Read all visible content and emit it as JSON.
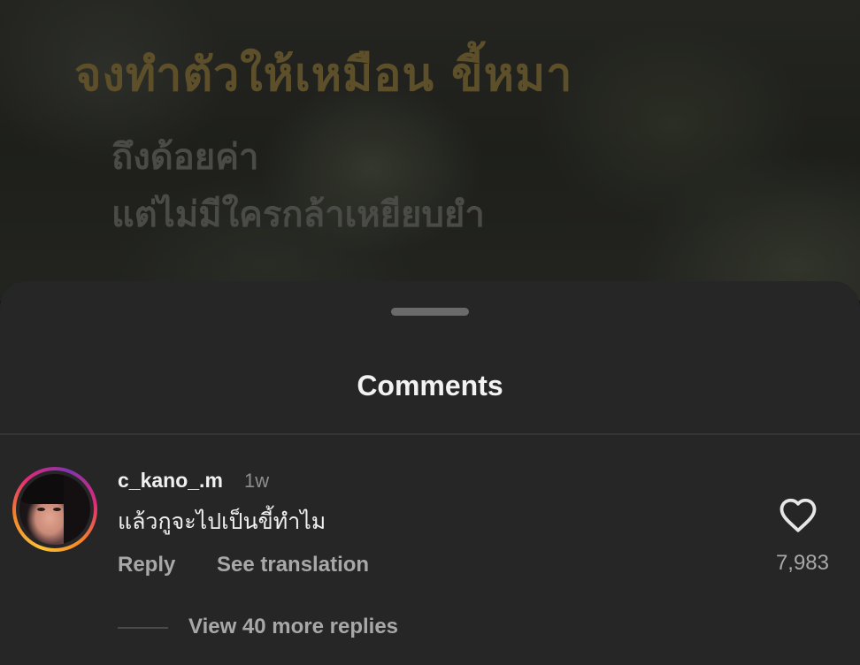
{
  "post": {
    "title": "จงทำตัวให้เหมือน ขี้หมา",
    "lines": [
      "ถึงด้อยค่า",
      "แต่ไม่มีใครกล้าเหยียบยำ"
    ]
  },
  "comments_sheet": {
    "title": "Comments",
    "comment": {
      "username": "c_kano_.m",
      "time": "1w",
      "text": "แล้วกูจะไปเป็นขี้ทำไม",
      "reply_label": "Reply",
      "translate_label": "See translation",
      "like_count": "7,983",
      "view_replies_label": "View 40 more replies"
    }
  },
  "icons": {
    "like": "heart-outline-icon"
  },
  "colors": {
    "sheet_bg": "#262626",
    "primary_text": "#f0f0f0",
    "secondary_text": "#a8a8a8",
    "post_title": "#5c4f2a"
  }
}
